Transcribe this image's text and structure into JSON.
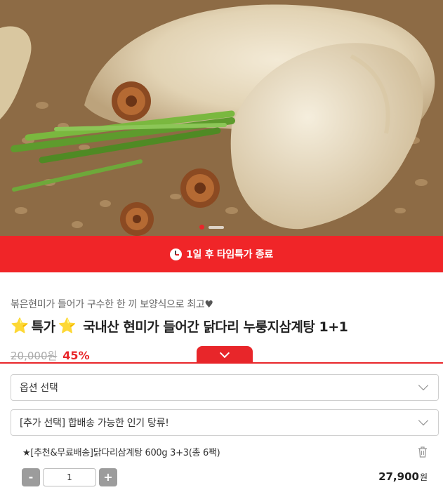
{
  "hero": {
    "image_icon": "samgyetang-photo",
    "slide_count": 3,
    "active_slide": 1
  },
  "timer": {
    "icon": "clock-icon",
    "text": "1일 후 타임특가 종료",
    "bg_color": "#f02528"
  },
  "product": {
    "subtitle": "볶은현미가 들어가 구수한 한 끼 보양식으로 최고",
    "subtitle_icon": "heart-icon",
    "title_prefix_star": "⭐",
    "badge": "특가",
    "title_suffix_star": "⭐",
    "name": "국내산 현미가 들어간 닭다리 누룽지삼계탕 1+1",
    "original_price": "20,000원",
    "discount": "45%"
  },
  "options": {
    "panel_toggle_icon": "chevron-down-icon",
    "select_main": "옵션 선택",
    "select_extra": "[추가 선택] 합배송 가능한 인기 탕류!"
  },
  "selected_item": {
    "name": "★[추천&무료배송]닭다리삼계탕 600g 3+3(총 6팩)",
    "quantity": "1",
    "minus": "-",
    "plus": "+",
    "price": "27,900",
    "unit": "원",
    "delete_icon": "trash-icon"
  },
  "colors": {
    "accent": "#e8262a",
    "star": "#f6b80f"
  }
}
